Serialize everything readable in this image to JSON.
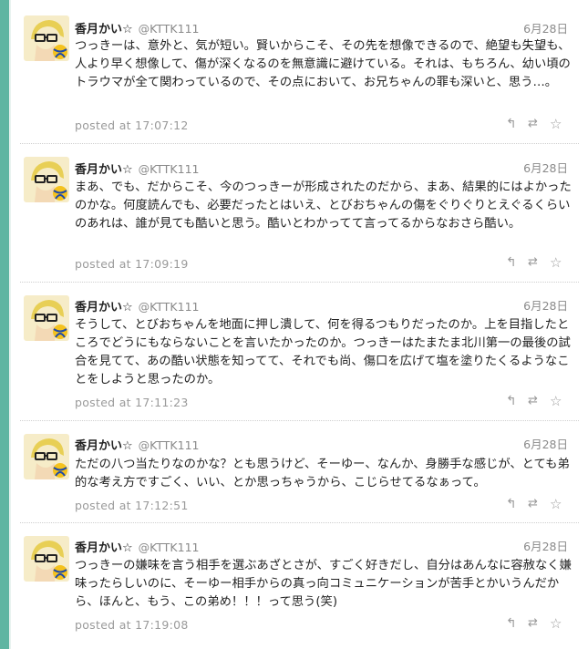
{
  "tweets": [
    {
      "name": "香月かい☆",
      "handle": "@KTTK111",
      "date": "6月28日",
      "text": "つっきーは、意外と、気が短い。賢いからこそ、その先を想像できるので、絶望も失望も、人より早く想像して、傷が深くなるのを無意識に避けている。それは、もちろん、幼い頃のトラウマが全て関わっているので、その点において、お兄ちゃんの罪も深いと、思う…。",
      "posted": "posted at 17:07:12"
    },
    {
      "name": "香月かい☆",
      "handle": "@KTTK111",
      "date": "6月28日",
      "text": "まあ、でも、だからこそ、今のつっきーが形成されたのだから、まあ、結果的にはよかったのかな。何度読んでも、必要だったとはいえ、とびおちゃんの傷をぐりぐりとえぐるくらいのあれは、誰が見ても酷いと思う。酷いとわかってて言ってるからなおさら酷い。",
      "posted": "posted at 17:09:19"
    },
    {
      "name": "香月かい☆",
      "handle": "@KTTK111",
      "date": "6月28日",
      "text": "そうして、とびおちゃんを地面に押し潰して、何を得るつもりだったのか。上を目指したところでどうにもならないことを言いたかったのか。つっきーはたまたま北川第一の最後の試合を見てて、あの酷い状態を知ってて、それでも尚、傷口を広げて塩を塗りたくるようなことをしようと思ったのか。",
      "posted": "posted at 17:11:23"
    },
    {
      "name": "香月かい☆",
      "handle": "@KTTK111",
      "date": "6月28日",
      "text": "ただの八つ当たりなのかな？とも思うけど、そーゆー、なんか、身勝手な感じが、とても弟的な考え方ですごく、いい、とか思っちゃうから、こじらせてるなぁって。",
      "posted": "posted at 17:12:51"
    },
    {
      "name": "香月かい☆",
      "handle": "@KTTK111",
      "date": "6月28日",
      "text": "つっきーの嫌味を言う相手を選ぶあざとさが、すごく好きだし、自分はあんなに容赦なく嫌味ったらしいのに、そーゆー相手からの真っ向コミュニケーションが苦手とかいうんだから、ほんと、もう、この弟め！！！って思う(笑)",
      "posted": "posted at 17:19:08"
    }
  ],
  "icons": {
    "reply": "reply-icon",
    "retweet": "retweet-icon",
    "favorite": "star-icon"
  },
  "colors": {
    "edge": "#5fb5a2",
    "text": "#222222",
    "muted": "#9a9a9a"
  }
}
